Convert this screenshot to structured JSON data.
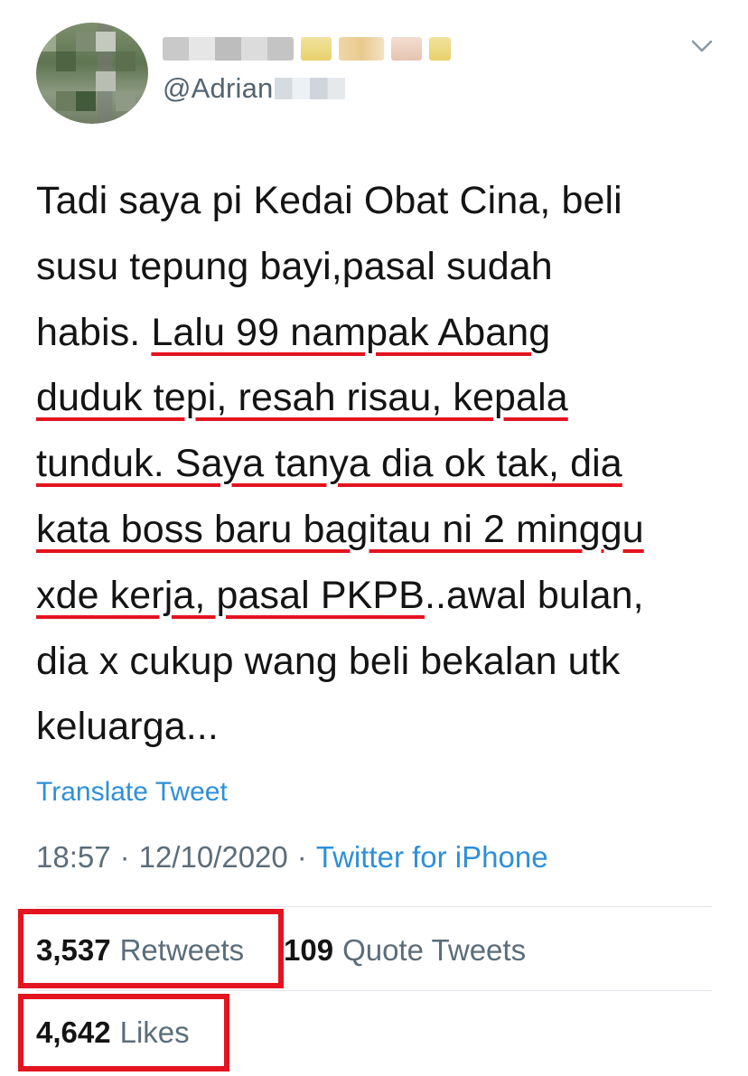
{
  "author": {
    "handle_visible": "@Adrian"
  },
  "tweet": {
    "line1": "Tadi saya pi Kedai Obat Cina, beli",
    "line2": "susu tepung bayi,pasal sudah",
    "line3a": "habis. ",
    "line3b": "Lalu 99 nampak Abang",
    "line4": "duduk tepi, resah risau, kepala",
    "line5": "tunduk. Saya tanya dia ok tak, dia",
    "line6": "kata boss baru bagitau ni 2 minggu",
    "line7a": "xde kerja, pasal PKPB",
    "line7b": "..awal bulan,",
    "line8": "dia x cukup wang beli bekalan utk",
    "line9": "keluarga..."
  },
  "translate_label": "Translate Tweet",
  "meta": {
    "time": "18:57",
    "separator": "·",
    "date": "12/10/2020",
    "source": "Twitter for iPhone"
  },
  "stats": {
    "retweets_count": "3,537",
    "retweets_label": "Retweets",
    "quotes_count": "109",
    "quotes_label": "Quote Tweets",
    "likes_count": "4,642",
    "likes_label": "Likes"
  },
  "icons": {
    "more": "chevron-down-icon"
  },
  "colors": {
    "link": "#2f8fd8",
    "highlight": "#e3141f",
    "secondary_text": "#5b6d7a"
  }
}
